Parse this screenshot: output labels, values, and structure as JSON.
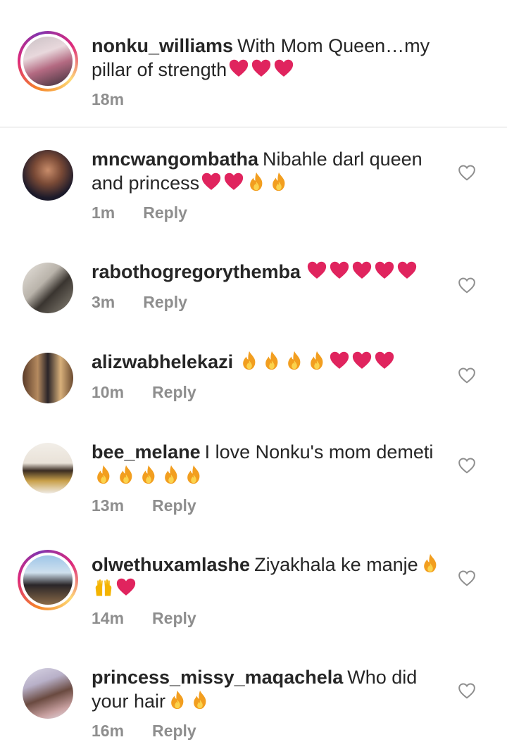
{
  "caption": {
    "username": "nonku_williams",
    "text": "With Mom Queen…my pillar of strength",
    "emojis": [
      "heart",
      "heart",
      "heart"
    ],
    "time": "18m"
  },
  "reply_label": "Reply",
  "comments": [
    {
      "username": "mncwangombatha",
      "text": "Nibahle darl queen and princess",
      "emojis": [
        "heart",
        "heart",
        "fire",
        "fire"
      ],
      "time": "1m"
    },
    {
      "username": "rabothogregorythemba",
      "text": "",
      "emojis": [
        "heart",
        "heart",
        "heart",
        "heart",
        "heart"
      ],
      "time": "3m"
    },
    {
      "username": "alizwabhelekazi",
      "text": "",
      "emojis": [
        "fire",
        "fire",
        "fire",
        "fire",
        "heart",
        "heart",
        "heart"
      ],
      "time": "10m"
    },
    {
      "username": "bee_melane",
      "text": "I love Nonku's mom demeti",
      "emojis": [
        "fire",
        "fire",
        "fire",
        "fire",
        "fire"
      ],
      "time": "13m"
    },
    {
      "username": "olwethuxamlashe",
      "text": "Ziyakhala ke manje",
      "emojis": [
        "fire",
        "raised-hands",
        "heart"
      ],
      "time": "14m"
    },
    {
      "username": "princess_missy_maqachela",
      "text": "Who did your hair",
      "emojis": [
        "fire",
        "fire"
      ],
      "time": "16m"
    }
  ],
  "colors": {
    "heart": "#e0245e",
    "fire": "#f29e1f",
    "meta": "#8e8e8e",
    "divider": "#dbdbdb"
  }
}
